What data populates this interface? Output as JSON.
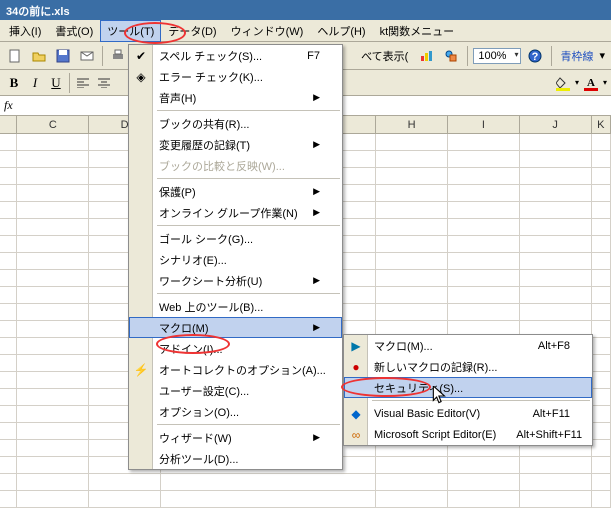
{
  "title": "34の前に.xls",
  "menubar": {
    "insert": "挿入(I)",
    "format": "書式(O)",
    "tools": "ツール(T)",
    "data": "データ(D)",
    "window": "ウィンドウ(W)",
    "help": "ヘルプ(H)",
    "kt": "kt関数メニュー"
  },
  "toolbar": {
    "showall": "べて表示(",
    "zoom": "100%",
    "lineframe": "青枠線"
  },
  "fx": "fx",
  "columns": [
    "C",
    "D",
    "H",
    "I",
    "J",
    "K"
  ],
  "tools_menu": {
    "spell": "スペル チェック(S)...",
    "spell_key": "F7",
    "error": "エラー チェック(K)...",
    "speech": "音声(H)",
    "share": "ブックの共有(R)...",
    "track": "変更履歴の記録(T)",
    "compare": "ブックの比較と反映(W)...",
    "protect": "保護(P)",
    "collab": "オンライン グループ作業(N)",
    "goal": "ゴール シーク(G)...",
    "scenario": "シナリオ(E)...",
    "wsanalysis": "ワークシート分析(U)",
    "webtools": "Web 上のツール(B)...",
    "macro": "マクロ(M)",
    "addin": "アドイン(I)...",
    "autocorrect": "オートコレクトのオプション(A)...",
    "customize": "ユーザー設定(C)...",
    "options": "オプション(O)...",
    "wizard": "ウィザード(W)",
    "analysis": "分析ツール(D)..."
  },
  "macro_menu": {
    "macros": "マクロ(M)...",
    "macros_key": "Alt+F8",
    "record": "新しいマクロの記録(R)...",
    "security": "セキュリティ(S)...",
    "vbe": "Visual Basic Editor(V)",
    "vbe_key": "Alt+F11",
    "mse": "Microsoft Script Editor(E)",
    "mse_key": "Alt+Shift+F11"
  }
}
